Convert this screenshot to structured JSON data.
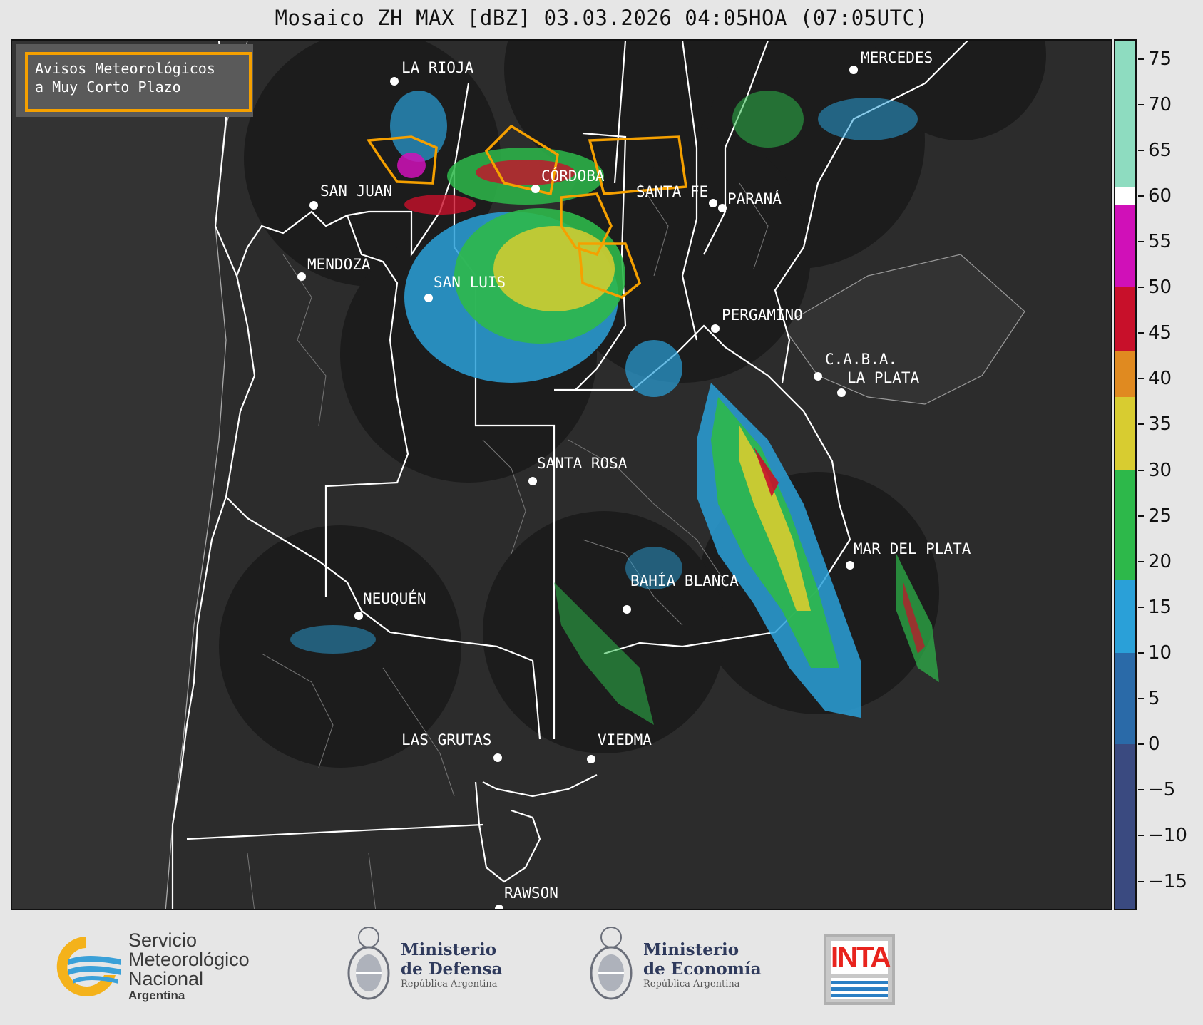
{
  "title": "Mosaico ZH MAX [dBZ] 03.03.2026 04:05HOA (07:05UTC)",
  "legend": {
    "line1": "Avisos Meteorológicos",
    "line2": "a Muy Corto Plazo",
    "border_color": "#f5a000"
  },
  "cities": [
    {
      "name": "LA RIOJA"
    },
    {
      "name": "SAN JUAN"
    },
    {
      "name": "CÓRDOBA"
    },
    {
      "name": "SANTA FE"
    },
    {
      "name": "PARANÁ"
    },
    {
      "name": "MENDOZA"
    },
    {
      "name": "SAN LUIS"
    },
    {
      "name": "MERCEDES"
    },
    {
      "name": "PERGAMINO"
    },
    {
      "name": "C.A.B.A."
    },
    {
      "name": "LA PLATA"
    },
    {
      "name": "SANTA ROSA"
    },
    {
      "name": "MAR DEL PLATA"
    },
    {
      "name": "BAHÍA BLANCA"
    },
    {
      "name": "NEUQUÉN"
    },
    {
      "name": "LAS GRUTAS"
    },
    {
      "name": "VIEDMA"
    },
    {
      "name": "RAWSON"
    }
  ],
  "colorbar": {
    "unit": "dBZ",
    "range": [
      -18,
      77
    ],
    "ticks": [
      "75",
      "70",
      "65",
      "60",
      "55",
      "50",
      "45",
      "40",
      "35",
      "30",
      "25",
      "20",
      "15",
      "10",
      "5",
      "0",
      "−5",
      "−10",
      "−15"
    ],
    "stops": [
      {
        "from": -18,
        "to": 0,
        "color": "#3a4a80"
      },
      {
        "from": 0,
        "to": 10,
        "color": "#2a6aa8"
      },
      {
        "from": 10,
        "to": 18,
        "color": "#2aa0d8"
      },
      {
        "from": 18,
        "to": 30,
        "color": "#2db84a"
      },
      {
        "from": 30,
        "to": 38,
        "color": "#d8cc30"
      },
      {
        "from": 38,
        "to": 43,
        "color": "#e08a20"
      },
      {
        "from": 43,
        "to": 50,
        "color": "#c8102a"
      },
      {
        "from": 50,
        "to": 59,
        "color": "#d010b8"
      },
      {
        "from": 59,
        "to": 61,
        "color": "#ffffff"
      },
      {
        "from": 61,
        "to": 77,
        "color": "#8edcc0"
      }
    ]
  },
  "footer": {
    "smn_line1": "Servicio",
    "smn_line2": "Meteorológico",
    "smn_line3": "Nacional",
    "smn_line4": "Argentina",
    "defensa_line1": "Ministerio",
    "defensa_line2": "de Defensa",
    "defensa_line3": "República Argentina",
    "economia_line1": "Ministerio",
    "economia_line2": "de Economía",
    "economia_line3": "República Argentina",
    "inta": "INTA"
  }
}
